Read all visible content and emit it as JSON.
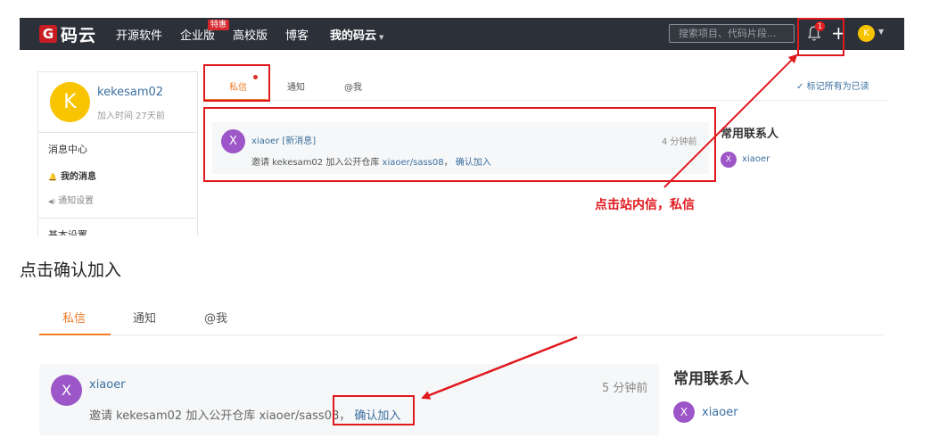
{
  "navbar": {
    "logo_mark": "G",
    "logo_text": "码云",
    "links": [
      "开源软件",
      "企业版",
      "高校版",
      "博客",
      "我的码云"
    ],
    "badge": "特惠",
    "search_placeholder": "搜索项目、代码片段...",
    "notification_count": "1",
    "plus": "+",
    "avatar_letter": "K",
    "caret": "▼"
  },
  "profile": {
    "avatar_letter": "K",
    "username": "kekesam02",
    "joined": "加入时间 27天前"
  },
  "sidebar": {
    "section_title": "消息中心",
    "my_messages": "我的消息",
    "notify_settings": "通知设置",
    "basic_settings": "基本设置",
    "bell_glyph": "🔔",
    "speaker_glyph": "◀)"
  },
  "tabs": {
    "items": [
      "私信",
      "通知",
      "@我"
    ],
    "active_index": 0,
    "mark_all_read": "标记所有为已读",
    "check_glyph": "✓"
  },
  "message_top": {
    "avatar_letter": "X",
    "sender": "xiaoer",
    "new_tag": "[新消息]",
    "time": "4 分钟前",
    "text_prefix": "邀请 kekesam02 加入公开仓库",
    "repo": "xiaoer/sass08",
    "separator": "，",
    "action": "确认加入"
  },
  "contacts_top": {
    "title": "常用联系人",
    "avatar_letter": "X",
    "name": "xiaoer"
  },
  "annotation": {
    "text": "点击站内信，私信",
    "color": "#e0191f"
  },
  "caption": "点击确认加入",
  "bottom_view": {
    "tabs": [
      "私信",
      "通知",
      "@我"
    ],
    "message": {
      "avatar_letter": "X",
      "sender": "xiaoer",
      "time": "5 分钟前",
      "text_prefix": "邀请 kekesam02 加入公开仓库 xiaoer/sass08",
      "separator": "，",
      "action": "确认加入"
    },
    "contacts": {
      "title": "常用联系人",
      "avatar_letter": "X",
      "name": "xiaoer"
    }
  },
  "colors": {
    "navbar_bg": "#2c3039",
    "accent_orange": "#f07a27",
    "link_blue": "#3b6fa0",
    "avatar_yellow": "#f8c400",
    "avatar_purple": "#9c56c7",
    "annotation_red": "#e0191f"
  }
}
